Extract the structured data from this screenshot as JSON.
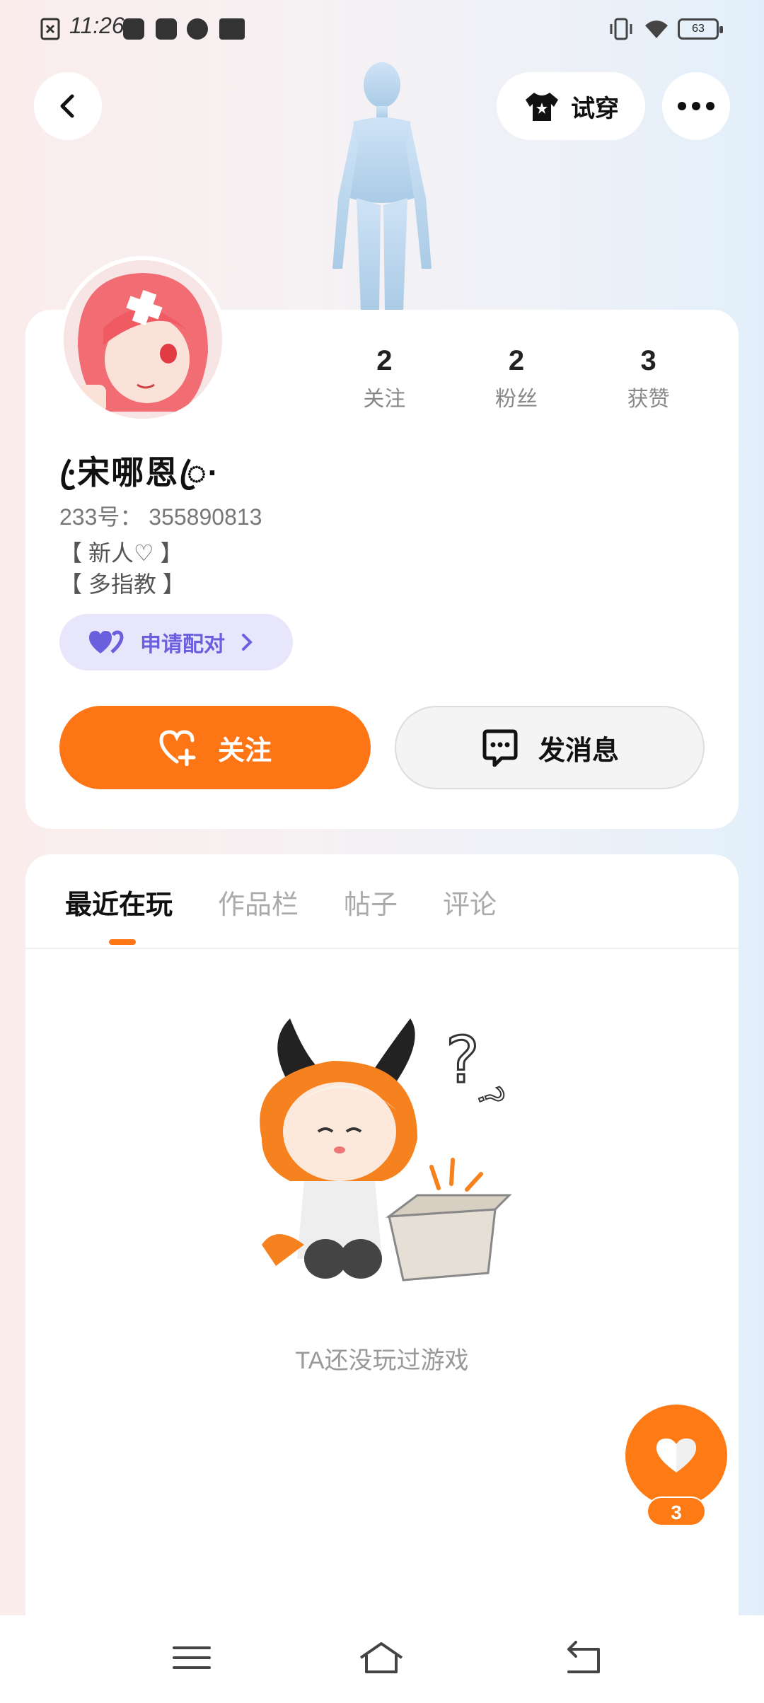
{
  "status_bar": {
    "time": "11:26",
    "battery": "63",
    "icons": [
      "sim-error-icon",
      "app-notification-icon",
      "wallet-icon",
      "speed-icon",
      "camera-icon",
      "vibrate-icon",
      "wifi-icon",
      "battery-icon"
    ]
  },
  "header": {
    "back_icon": "back-arrow-icon",
    "tryon_label": "试穿",
    "more_icon": "more-dots-icon"
  },
  "profile": {
    "username": "·ꦿ宋哪恩ꦿ·",
    "uid": "233号： 355890813",
    "bio_lines": [
      "【 新人♡ 】",
      "【 多指教 】"
    ],
    "stats": [
      {
        "value": "2",
        "label": "关注"
      },
      {
        "value": "2",
        "label": "粉丝"
      },
      {
        "value": "3",
        "label": "获赞"
      }
    ],
    "pair_label": "申请配对",
    "follow_label": "关注",
    "message_label": "发消息"
  },
  "tabs": {
    "items": [
      "最近在玩",
      "作品栏",
      "帖子",
      "评论"
    ],
    "active": "最近在玩"
  },
  "empty_state": {
    "text": "TA还没玩过游戏"
  },
  "like_fab": {
    "count": "3"
  },
  "colors": {
    "accent": "#fe7516",
    "pair_bg": "#e8e6fb",
    "pair_text": "#6a5fdc"
  }
}
